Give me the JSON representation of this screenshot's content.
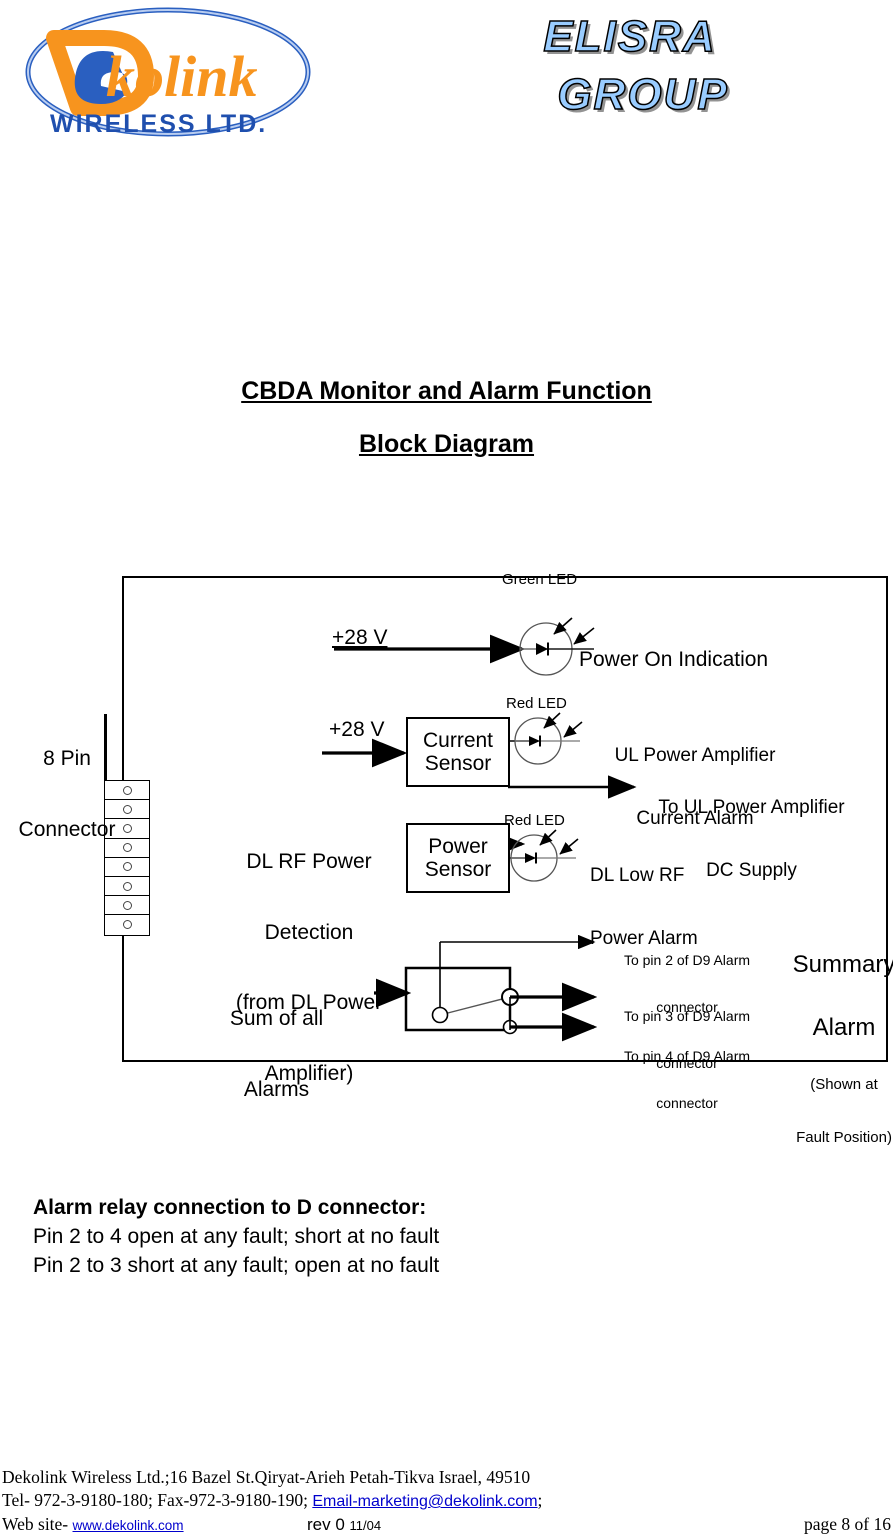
{
  "header": {
    "logo_left": {
      "brand": "Dekolink",
      "brand_prefix": "De",
      "brand_suffix": "kolink",
      "tagline": "WIRELESS LTD."
    },
    "logo_right": {
      "line1": "ELISRA",
      "line2": "GROUP",
      "fill_color": "#99ccff",
      "shadow_color": "#808080"
    }
  },
  "title": {
    "line1": "CBDA Monitor and Alarm Function",
    "line2": "Block Diagram"
  },
  "diagram": {
    "connector": {
      "label_line1": "8 Pin",
      "label_line2": "Connector",
      "pin_count": 8
    },
    "rows": {
      "power_on": {
        "input": "+28 V",
        "led_label": "Green LED",
        "output": "Power On Indication"
      },
      "current_sensor": {
        "input": "+28 V",
        "box_line1": "Current",
        "box_line2": "Sensor",
        "led_label": "Red LED",
        "alarm_line1": "UL Power Amplifier",
        "alarm_line2": "Current Alarm",
        "supply_line1": "To UL Power Amplifier",
        "supply_line2": "DC Supply"
      },
      "power_sensor": {
        "input_line1": "DL RF Power",
        "input_line2": "Detection",
        "input_line3": "(from DL Power",
        "input_line4": "Amplifier)",
        "box_line1": "Power",
        "box_line2": "Sensor",
        "led_label": "Red LED",
        "alarm_line1": "DL Low RF",
        "alarm_line2": "Power Alarm"
      },
      "relay": {
        "input_line1": "Sum of all",
        "input_line2": "Alarms",
        "pin2_line1": "To pin 2 of D9 Alarm",
        "pin2_line2": "connector",
        "pin3_line1": "To pin 3 of D9 Alarm",
        "pin3_line2": "connector",
        "pin4_line1": "To pin 4 of D9 Alarm",
        "pin4_line2": "connector",
        "summary_line1": "Summary",
        "summary_line2": "Alarm",
        "summary_note1": "(Shown at",
        "summary_note2": "Fault Position)"
      }
    }
  },
  "notes": {
    "heading": "Alarm relay connection to D connector:",
    "line1": "Pin 2 to 4 open at any fault; short at no fault",
    "line2": "Pin 2 to 3 short at any fault; open at no fault"
  },
  "footer": {
    "line1": "Dekolink Wireless Ltd.;16 Bazel St.Qiryat-Arieh Petah-Tikva Israel, 49510",
    "line2_prefix": "Tel- 972-3-9180-180; Fax-972-3-9180-190; ",
    "email": "Email-marketing@dekolink.com",
    "line2_suffix": ";",
    "line3_prefix": "Web site- ",
    "website": "www.dekolink.com",
    "revision": "rev 0",
    "revision_date": "11/04",
    "page": "page 8 of  16"
  }
}
